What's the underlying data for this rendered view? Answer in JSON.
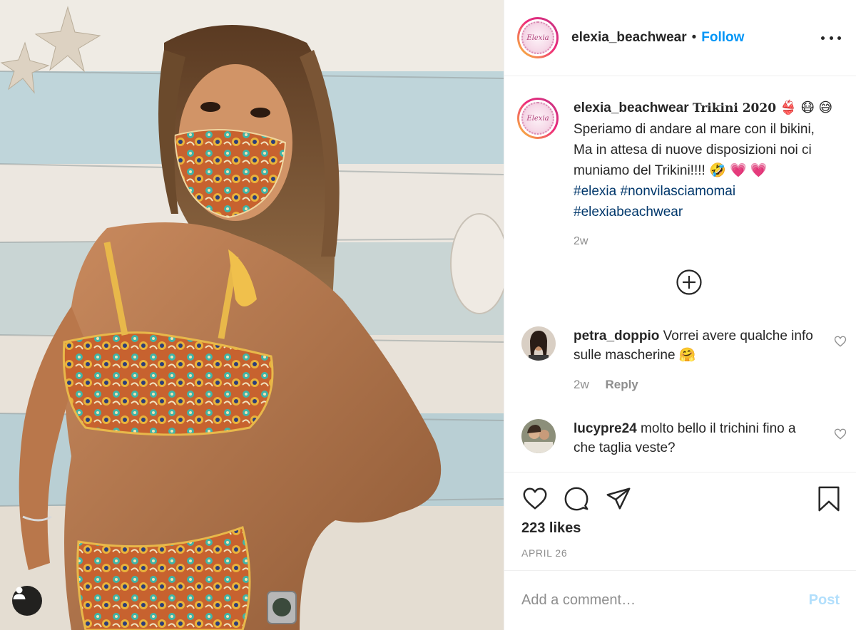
{
  "post": {
    "username": "elexia_beachwear",
    "follow_label": "Follow",
    "separator": "•",
    "avatar_text": "Elexia",
    "photo_alt": "Woman wearing patterned bikini and matching face mask"
  },
  "caption": {
    "username": "elexia_beachwear",
    "title": "Trikini 2020",
    "title_emojis": "👙 😷 😅",
    "line1": "Speriamo di andare al mare con il bikini,",
    "line2": "Ma in attesa di nuove disposizioni noi ci",
    "line3": "muniamo del Trikini!!!! 🤣 💗 💗",
    "hashtag1": "#elexia",
    "hashtag2": "#nonvilasciamomai",
    "hashtag3": "#elexiabeachwear",
    "time": "2w"
  },
  "comments": [
    {
      "username": "petra_doppio",
      "text": "Vorrei avere qualche info sulle mascherine 🤗",
      "time": "2w",
      "reply_label": "Reply"
    },
    {
      "username": "lucypre24",
      "text": "molto bello il trichini fino a che taglia veste?"
    }
  ],
  "actions": {
    "likes": "223 likes",
    "date": "APRIL 26"
  },
  "add_comment": {
    "placeholder": "Add a comment…",
    "post_label": "Post"
  },
  "icons": {
    "more": "more-options-icon",
    "load_more": "plus-circle-icon",
    "like": "heart-icon",
    "comment": "comment-bubble-icon",
    "share": "paper-plane-icon",
    "save": "bookmark-icon",
    "user_tags": "user-tag-icon"
  },
  "colors": {
    "follow": "#0095f6",
    "hashtag": "#00376b",
    "muted": "#8e8e8e",
    "post_disabled": "#b2dffc"
  }
}
